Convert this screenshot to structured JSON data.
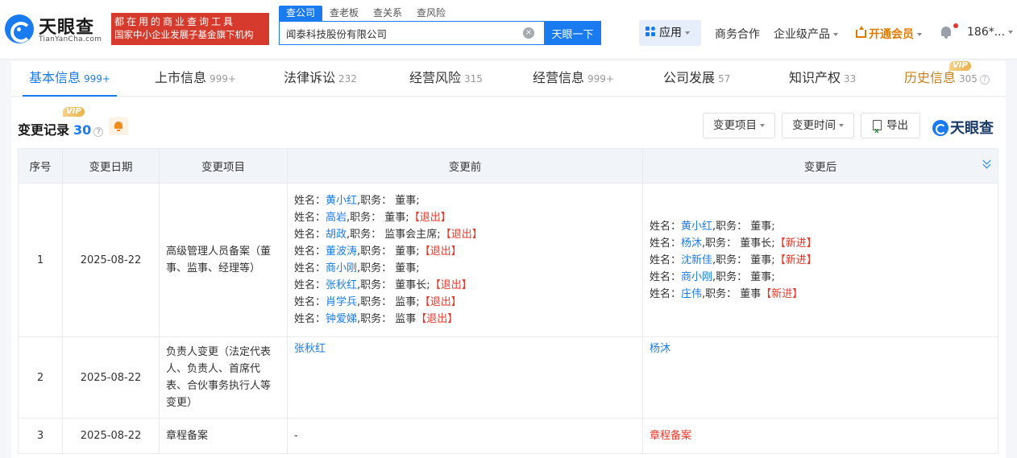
{
  "brand": {
    "name": "天眼查",
    "domain": "TianYanCha.com",
    "slogan_line1": "都在用的商业查询工具",
    "slogan_line2": "国家中小企业发展子基金旗下机构"
  },
  "search": {
    "tabs": [
      "查公司",
      "查老板",
      "查关系",
      "查风险"
    ],
    "active_tab": 0,
    "value": "闻泰科技股份有限公司",
    "button": "天眼一下",
    "clear": "×"
  },
  "topnav": {
    "apps": "应用",
    "business": "商务合作",
    "enterprise": "企业级产品",
    "member": "开通会员",
    "user": "186*..."
  },
  "tabs": [
    {
      "label": "基本信息",
      "count": "999+"
    },
    {
      "label": "上市信息",
      "count": "999+"
    },
    {
      "label": "法律诉讼",
      "count": "232"
    },
    {
      "label": "经营风险",
      "count": "315"
    },
    {
      "label": "经营信息",
      "count": "999+"
    },
    {
      "label": "公司发展",
      "count": "57"
    },
    {
      "label": "知识产权",
      "count": "33"
    },
    {
      "label": "历史信息",
      "count": "305"
    }
  ],
  "vip": "VIP",
  "section": {
    "title": "变更记录",
    "count": "30",
    "filter_item": "变更项目",
    "filter_time": "变更时间",
    "export": "导出",
    "watermark": "天眼查"
  },
  "table": {
    "headers": [
      "序号",
      "变更日期",
      "变更项目",
      "变更前",
      "变更后"
    ],
    "rows": [
      {
        "index": "1",
        "date": "2025-08-22",
        "item": "高级管理人员备案（董事、监事、经理等）",
        "before": [
          {
            "prefix": "姓名：",
            "name": "黄小红",
            "role": ",职务： 董事;",
            "tag": ""
          },
          {
            "prefix": "姓名：",
            "name": "高岩",
            "role": ",职务： 董事;",
            "tag": "【退出】"
          },
          {
            "prefix": "姓名：",
            "name": "胡政",
            "role": ",职务： 监事会主席;",
            "tag": "【退出】"
          },
          {
            "prefix": "姓名：",
            "name": "董波涛",
            "role": ",职务： 董事;",
            "tag": "【退出】"
          },
          {
            "prefix": "姓名：",
            "name": "商小刚",
            "role": ",职务： 董事;",
            "tag": ""
          },
          {
            "prefix": "姓名：",
            "name": "张秋红",
            "role": ",职务： 董事长;",
            "tag": "【退出】"
          },
          {
            "prefix": "姓名：",
            "name": "肖学兵",
            "role": ",职务： 监事;",
            "tag": "【退出】"
          },
          {
            "prefix": "姓名：",
            "name": "钟爱娣",
            "role": ",职务： 监事",
            "tag": "【退出】"
          }
        ],
        "after": [
          {
            "prefix": "姓名：",
            "name": "黄小红",
            "role": ",职务： 董事;",
            "tag": ""
          },
          {
            "prefix": "姓名：",
            "name": "杨沐",
            "role": ",职务： 董事长;",
            "tag": "【新进】"
          },
          {
            "prefix": "姓名：",
            "name": "沈新佳",
            "role": ",职务： 董事;",
            "tag": "【新进】"
          },
          {
            "prefix": "姓名：",
            "name": "商小刚",
            "role": ",职务： 董事;",
            "tag": ""
          },
          {
            "prefix": "姓名：",
            "name": "庄伟",
            "role": ",职务： 董事",
            "tag": "【新进】"
          }
        ]
      },
      {
        "index": "2",
        "date": "2025-08-22",
        "item": "负责人变更（法定代表人、负责人、首席代表、合伙事务执行人等变更）",
        "before_text": "张秋红",
        "after_text": "杨沐"
      },
      {
        "index": "3",
        "date": "2025-08-22",
        "item": "章程备案",
        "before_text": "-",
        "after_text": "章程备案"
      }
    ]
  }
}
